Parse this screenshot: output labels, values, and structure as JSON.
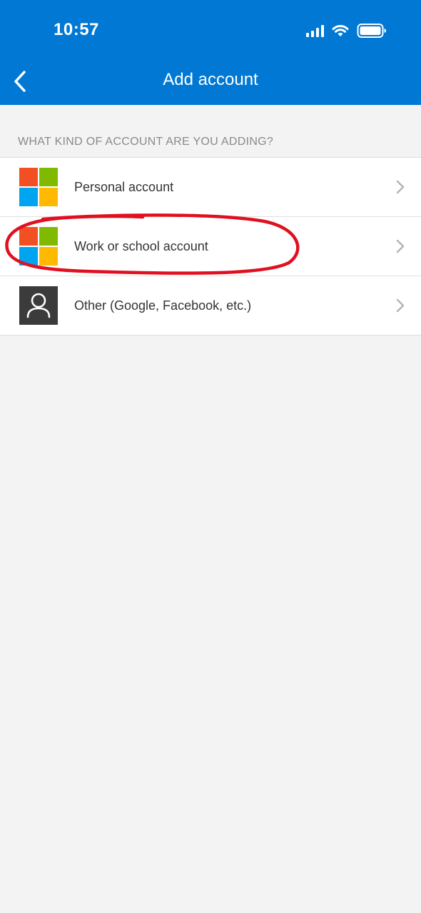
{
  "status_bar": {
    "time": "10:57",
    "icons": [
      "signal-icon",
      "wifi-icon",
      "battery-icon"
    ]
  },
  "nav": {
    "title": "Add account",
    "back_icon": "chevron-left-icon"
  },
  "section": {
    "header": "WHAT KIND OF ACCOUNT ARE YOU ADDING?"
  },
  "accounts": [
    {
      "label": "Personal account",
      "icon": "microsoft-logo-icon"
    },
    {
      "label": "Work or school account",
      "icon": "microsoft-logo-icon"
    },
    {
      "label": "Other (Google, Facebook, etc.)",
      "icon": "person-icon"
    }
  ],
  "colors": {
    "header_bg": "#0078d4",
    "page_bg": "#f3f3f3",
    "ms_red": "#f25022",
    "ms_green": "#7fba00",
    "ms_blue": "#00a4ef",
    "ms_yellow": "#ffb900",
    "annotation": "#e0101f"
  }
}
